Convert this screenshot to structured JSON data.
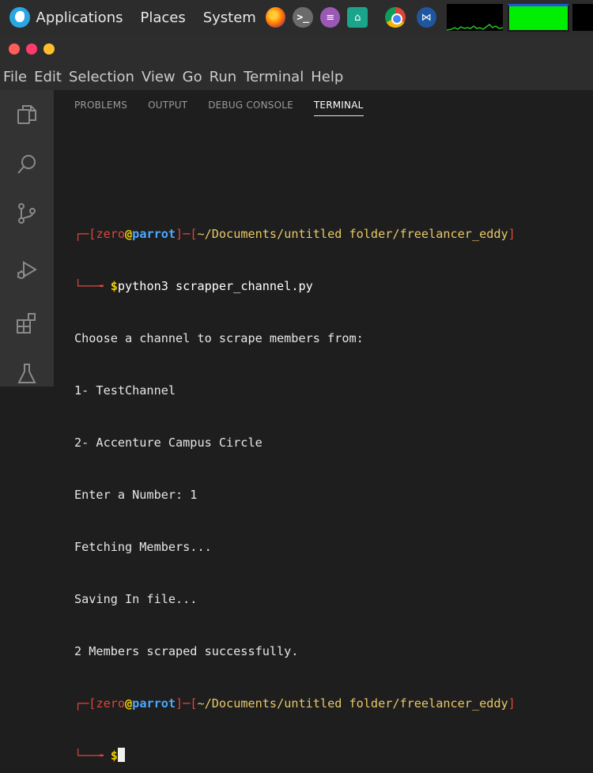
{
  "system_panel": {
    "menus": [
      "Applications",
      "Places",
      "System"
    ],
    "launchers": [
      {
        "name": "firefox-icon",
        "glyph": ""
      },
      {
        "name": "terminal-icon",
        "glyph": ">_"
      },
      {
        "name": "text-editor-icon",
        "glyph": "≡"
      },
      {
        "name": "home-folder-icon",
        "glyph": "⌂"
      },
      {
        "name": "chrome-icon",
        "glyph": ""
      },
      {
        "name": "vscode-icon",
        "glyph": "⋈"
      }
    ]
  },
  "menubar": {
    "items": [
      "File",
      "Edit",
      "Selection",
      "View",
      "Go",
      "Run",
      "Terminal",
      "Help"
    ]
  },
  "panel": {
    "tabs": [
      {
        "label": "PROBLEMS",
        "active": false
      },
      {
        "label": "OUTPUT",
        "active": false
      },
      {
        "label": "DEBUG CONSOLE",
        "active": false
      },
      {
        "label": "TERMINAL",
        "active": true
      }
    ]
  },
  "terminal": {
    "prompt1": {
      "corner": "┌─[",
      "user": "zero",
      "at": "@",
      "host": "parrot",
      "sep": "]─[",
      "path": "~/Documents/untitled folder/freelancer_eddy",
      "end": "]"
    },
    "command_arrow": "└──╼ ",
    "dollar": "$",
    "command": "python3 scrapper_channel.py",
    "output": [
      "Choose a channel to scrape members from:",
      "1- TestChannel",
      "2- Accenture Campus Circle",
      "Enter a Number: 1",
      "Fetching Members...",
      "Saving In file...",
      "2 Members scraped successfully."
    ],
    "prompt2": {
      "corner": "┌─[",
      "user": "zero",
      "at": "@",
      "host": "parrot",
      "sep": "]─[",
      "path": "~/Documents/untitled folder/freelancer_eddy",
      "end": "]"
    }
  },
  "colors": {
    "panel_bg": "#2c2c2c",
    "editor_bg": "#1e1e1e",
    "activity_bg": "#333333",
    "prompt_red": "#e0443c",
    "host_blue": "#4aa8ff",
    "path_yellow": "#e8c866"
  }
}
